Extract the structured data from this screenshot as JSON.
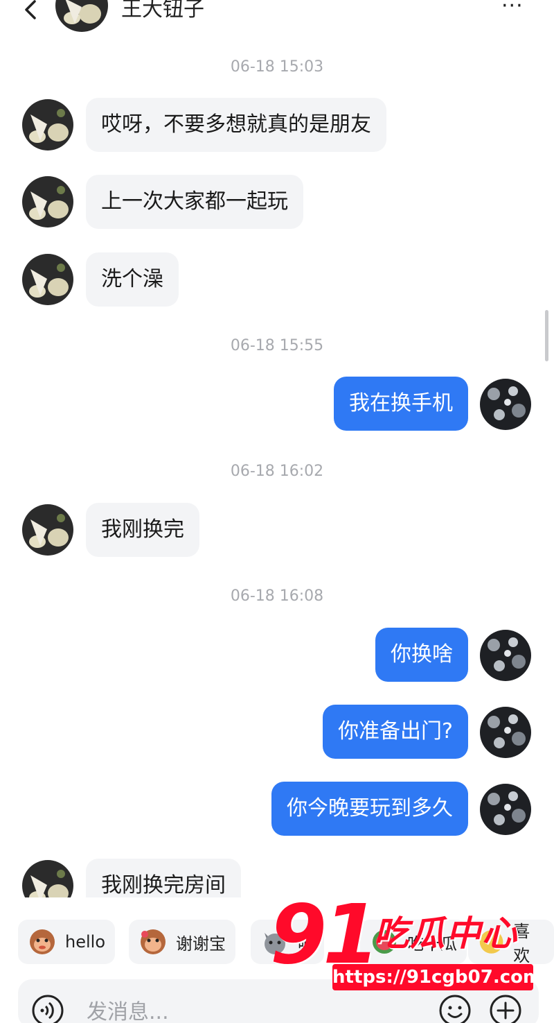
{
  "header": {
    "title": "王大钮子",
    "more_label": "···"
  },
  "messages": [
    {
      "type": "time",
      "text": "06-18 15:03"
    },
    {
      "type": "in",
      "text": "哎呀，不要多想就真的是朋友"
    },
    {
      "type": "in",
      "text": "上一次大家都一起玩"
    },
    {
      "type": "in",
      "text": "洗个澡"
    },
    {
      "type": "time",
      "text": "06-18 15:55"
    },
    {
      "type": "out",
      "text": "我在换手机"
    },
    {
      "type": "time",
      "text": "06-18 16:02"
    },
    {
      "type": "in",
      "text": "我刚换完"
    },
    {
      "type": "time",
      "text": "06-18 16:08"
    },
    {
      "type": "out",
      "text": "你换啥"
    },
    {
      "type": "out",
      "text": "你准备出门?"
    },
    {
      "type": "out",
      "text": "你今晚要玩到多久"
    },
    {
      "type": "in",
      "text": "我刚换完房间"
    }
  ],
  "quick_replies": [
    "hello",
    "谢谢宝",
    "呃",
    "吃十瓜",
    "喜欢"
  ],
  "input": {
    "placeholder": "发消息..."
  },
  "watermark": {
    "number": "91",
    "name": "吃瓜中心",
    "url": "https://91cgb07.com"
  },
  "colors": {
    "outgoing_bubble": "#2f79f4",
    "incoming_bubble": "#f3f4f6",
    "timestamp": "#a7a9ae",
    "watermark_red": "#ff0a2a"
  }
}
